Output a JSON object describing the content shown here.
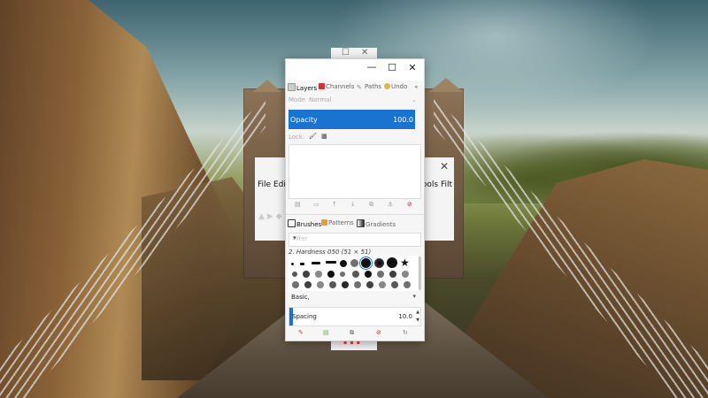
{
  "dock": {
    "window_controls": {
      "minimize": "—",
      "maximize": "☐",
      "close": "✕"
    },
    "tabs": [
      {
        "label": "Layers",
        "icon": "layers-icon",
        "color": "#cccccc",
        "active": true
      },
      {
        "label": "Channels",
        "icon": "channels-icon",
        "color": "#cc3333",
        "active": false
      },
      {
        "label": "Paths",
        "icon": "paths-icon",
        "color": "#888888",
        "active": false
      },
      {
        "label": "Undo",
        "icon": "undo-icon",
        "color": "#d9b84a",
        "active": false
      }
    ],
    "mode": {
      "label": "Mode",
      "value": "Normal"
    },
    "opacity": {
      "label": "Opacity",
      "value": "100.0"
    },
    "lock_label": "Lock:",
    "brush_tabs": [
      {
        "label": "Brushes",
        "icon": "brushes-icon",
        "color": "#333333",
        "active": true
      },
      {
        "label": "Patterns",
        "icon": "patterns-icon",
        "color": "#e0a040",
        "active": false
      },
      {
        "label": "Gradients",
        "icon": "gradients-icon",
        "color": "#444444",
        "active": false
      }
    ],
    "filter_placeholder": "filter",
    "selected_brush": "2. Hardness 050 (51 × 51)",
    "preset": "Basic,",
    "spacing": {
      "label": "Spacing",
      "value": "10.0"
    }
  },
  "background_window": {
    "menu_left": "File  Edi",
    "menu_right": "Tools  Filt",
    "close": "✕"
  },
  "accent_color": "#1a73d1"
}
